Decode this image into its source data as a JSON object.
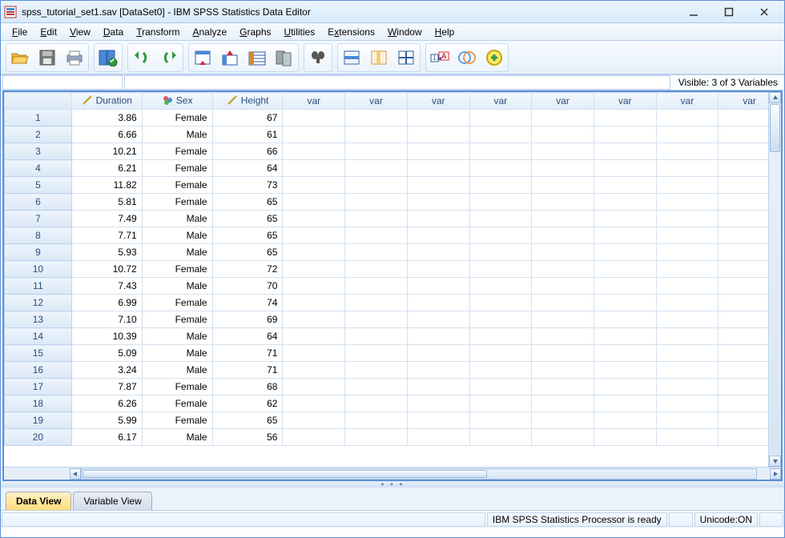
{
  "titlebar": {
    "text": "spss_tutorial_set1.sav [DataSet0] - IBM SPSS Statistics Data Editor"
  },
  "menu": {
    "file": "File",
    "edit": "Edit",
    "view": "View",
    "data": "Data",
    "transform": "Transform",
    "analyze": "Analyze",
    "graphs": "Graphs",
    "utilities": "Utilities",
    "extensions": "Extensions",
    "window": "Window",
    "help": "Help"
  },
  "status_header": {
    "visible_vars": "Visible: 3 of 3 Variables"
  },
  "columns": {
    "defined": [
      {
        "name": "Duration",
        "type": "scale"
      },
      {
        "name": "Sex",
        "type": "nominal"
      },
      {
        "name": "Height",
        "type": "scale"
      }
    ],
    "placeholder": "var"
  },
  "rows": [
    {
      "n": 1,
      "Duration": "3.86",
      "Sex": "Female",
      "Height": "67"
    },
    {
      "n": 2,
      "Duration": "6.66",
      "Sex": "Male",
      "Height": "61"
    },
    {
      "n": 3,
      "Duration": "10.21",
      "Sex": "Female",
      "Height": "66"
    },
    {
      "n": 4,
      "Duration": "6.21",
      "Sex": "Female",
      "Height": "64"
    },
    {
      "n": 5,
      "Duration": "11.82",
      "Sex": "Female",
      "Height": "73"
    },
    {
      "n": 6,
      "Duration": "5.81",
      "Sex": "Female",
      "Height": "65"
    },
    {
      "n": 7,
      "Duration": "7.49",
      "Sex": "Male",
      "Height": "65"
    },
    {
      "n": 8,
      "Duration": "7.71",
      "Sex": "Male",
      "Height": "65"
    },
    {
      "n": 9,
      "Duration": "5.93",
      "Sex": "Male",
      "Height": "65"
    },
    {
      "n": 10,
      "Duration": "10.72",
      "Sex": "Female",
      "Height": "72"
    },
    {
      "n": 11,
      "Duration": "7.43",
      "Sex": "Male",
      "Height": "70"
    },
    {
      "n": 12,
      "Duration": "6.99",
      "Sex": "Female",
      "Height": "74"
    },
    {
      "n": 13,
      "Duration": "7.10",
      "Sex": "Female",
      "Height": "69"
    },
    {
      "n": 14,
      "Duration": "10.39",
      "Sex": "Male",
      "Height": "64"
    },
    {
      "n": 15,
      "Duration": "5.09",
      "Sex": "Male",
      "Height": "71"
    },
    {
      "n": 16,
      "Duration": "3.24",
      "Sex": "Male",
      "Height": "71"
    },
    {
      "n": 17,
      "Duration": "7.87",
      "Sex": "Female",
      "Height": "68"
    },
    {
      "n": 18,
      "Duration": "6.26",
      "Sex": "Female",
      "Height": "62"
    },
    {
      "n": 19,
      "Duration": "5.99",
      "Sex": "Female",
      "Height": "65"
    },
    {
      "n": 20,
      "Duration": "6.17",
      "Sex": "Male",
      "Height": "56"
    }
  ],
  "view_tabs": {
    "data_view": "Data View",
    "variable_view": "Variable View"
  },
  "statusbar": {
    "processor": "IBM SPSS Statistics Processor is ready",
    "unicode": "Unicode:ON"
  }
}
